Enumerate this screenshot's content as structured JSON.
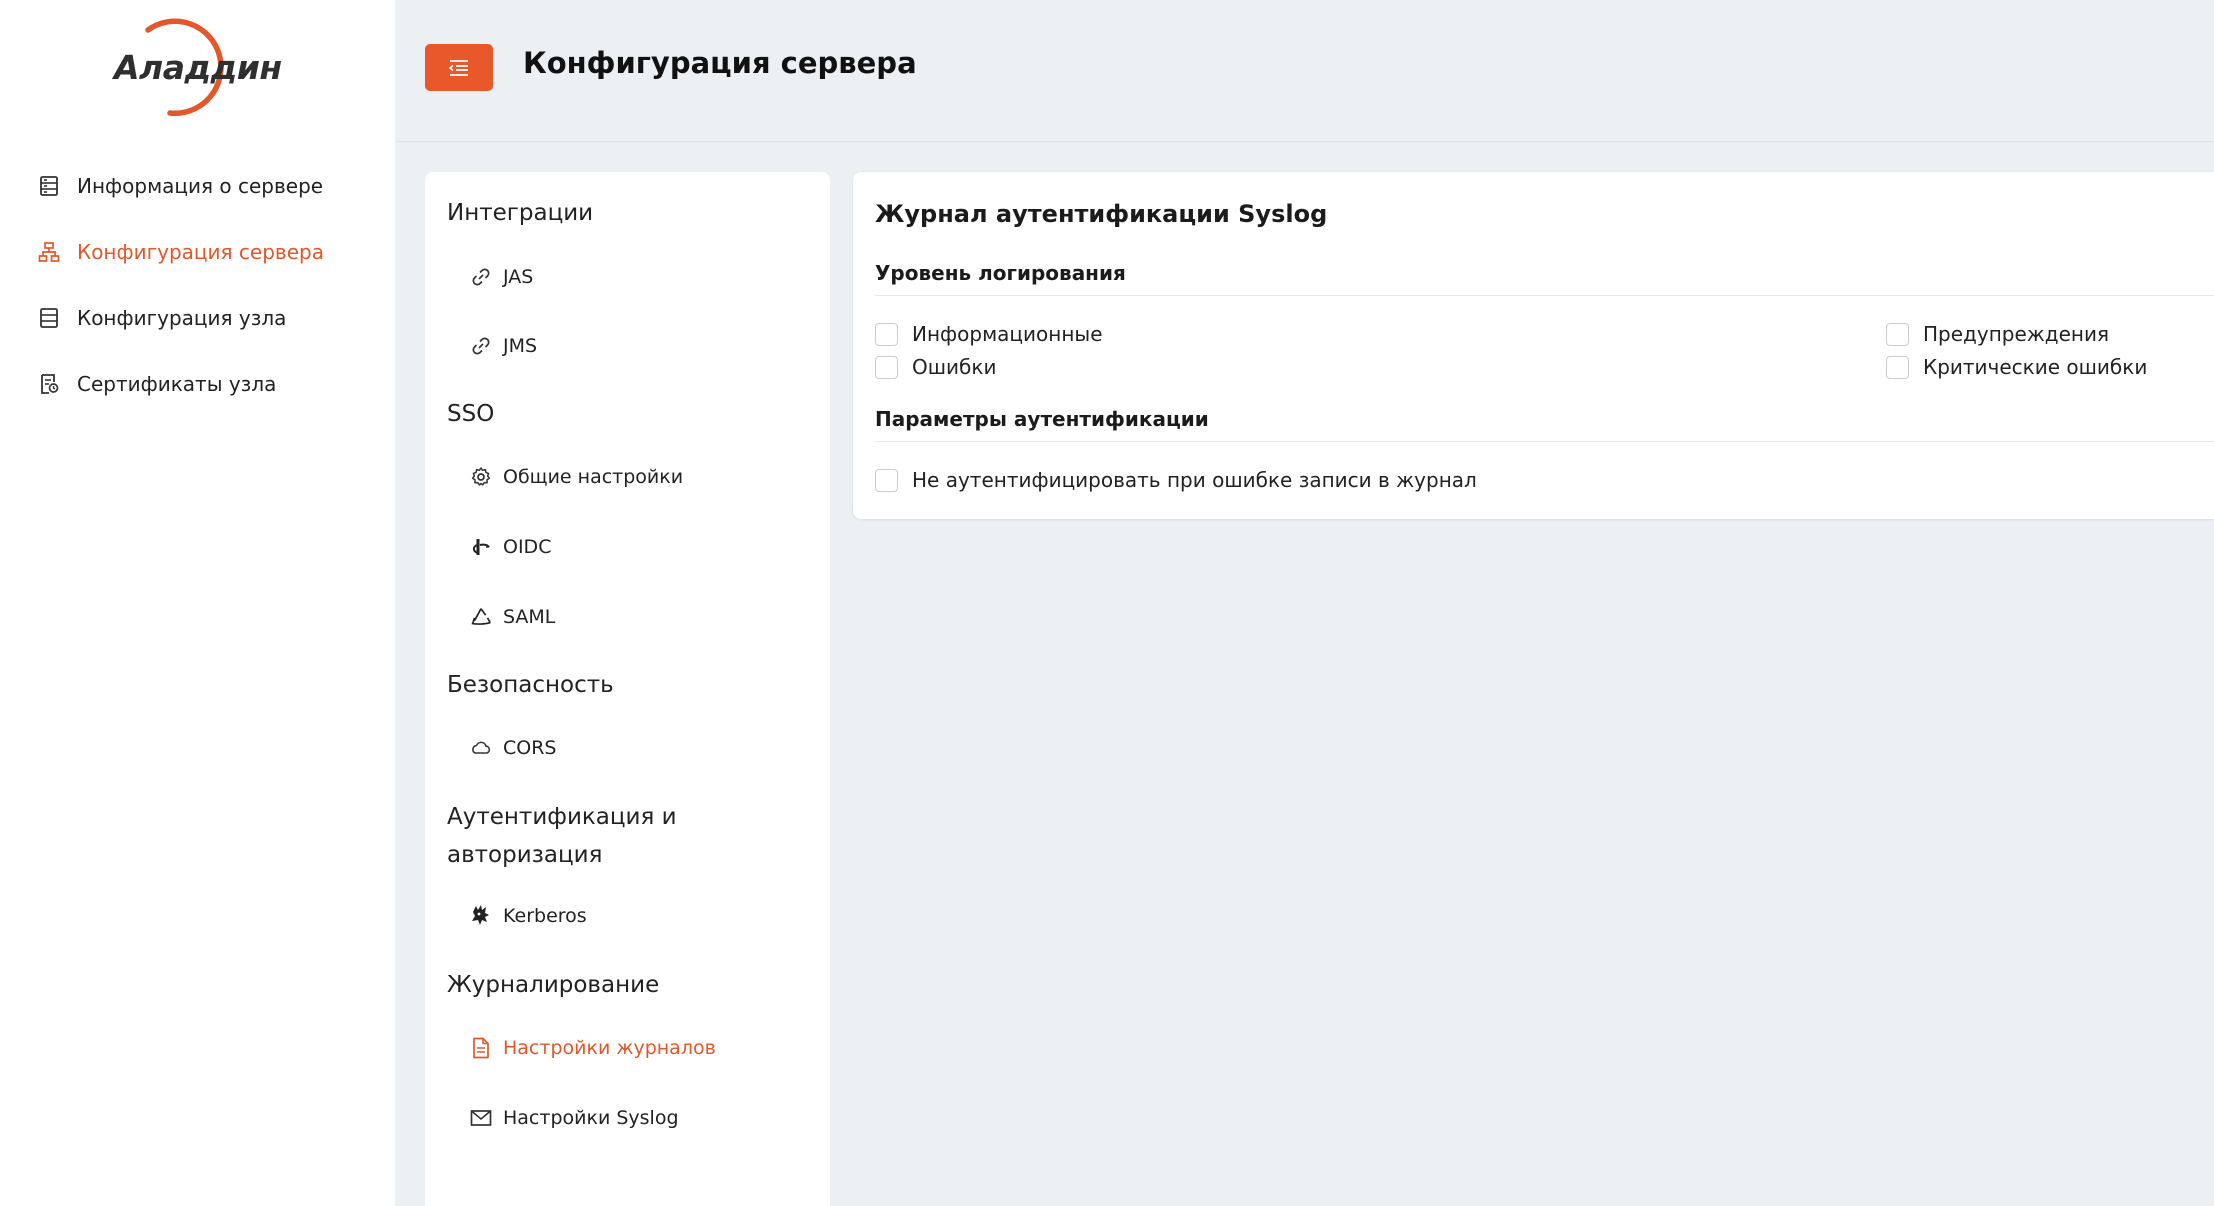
{
  "brand": {
    "logo_text": "Аладдин",
    "accent": "#e8582a"
  },
  "sidebar": {
    "items": [
      {
        "label": "Информация о сервере",
        "icon": "server-info-icon",
        "active": false
      },
      {
        "label": "Конфигурация сервера",
        "icon": "server-config-icon",
        "active": true
      },
      {
        "label": "Конфигурация узла",
        "icon": "node-config-icon",
        "active": false
      },
      {
        "label": "Сертификаты узла",
        "icon": "certificate-icon",
        "active": false
      }
    ]
  },
  "header": {
    "title": "Конфигурация сервера",
    "menu_icon": "menu-collapse-icon"
  },
  "settings_menu": {
    "groups": [
      {
        "title": "Интеграции",
        "items": [
          {
            "label": "JAS",
            "icon": "link-icon"
          },
          {
            "label": "JMS",
            "icon": "link-icon"
          }
        ]
      },
      {
        "title": "SSO",
        "items": [
          {
            "label": "Общие настройки",
            "icon": "gear-icon"
          },
          {
            "label": "OIDC",
            "icon": "oidc-icon"
          },
          {
            "label": "SAML",
            "icon": "saml-icon"
          }
        ]
      },
      {
        "title": "Безопасность",
        "items": [
          {
            "label": "CORS",
            "icon": "cloud-icon"
          }
        ]
      },
      {
        "title_line1": "Аутентификация и",
        "title_line2": "авторизация",
        "items": [
          {
            "label": "Kerberos",
            "icon": "kerberos-icon"
          }
        ]
      },
      {
        "title": "Журналирование",
        "items": [
          {
            "label": "Настройки журналов",
            "icon": "document-icon",
            "active": true
          },
          {
            "label": "Настройки Syslog",
            "icon": "mail-icon"
          }
        ]
      }
    ]
  },
  "content": {
    "title": "Журнал аутентификации Syslog",
    "log_level": {
      "title": "Уровень логирования",
      "options": [
        {
          "label": "Информационные",
          "checked": false
        },
        {
          "label": "Ошибки",
          "checked": false
        },
        {
          "label": "Предупреждения",
          "checked": false
        },
        {
          "label": "Критические ошибки",
          "checked": false
        }
      ]
    },
    "auth_params": {
      "title": "Параметры аутентификации",
      "options": [
        {
          "label": "Не аутентифицировать при ошибке записи в журнал",
          "checked": false
        }
      ]
    }
  }
}
